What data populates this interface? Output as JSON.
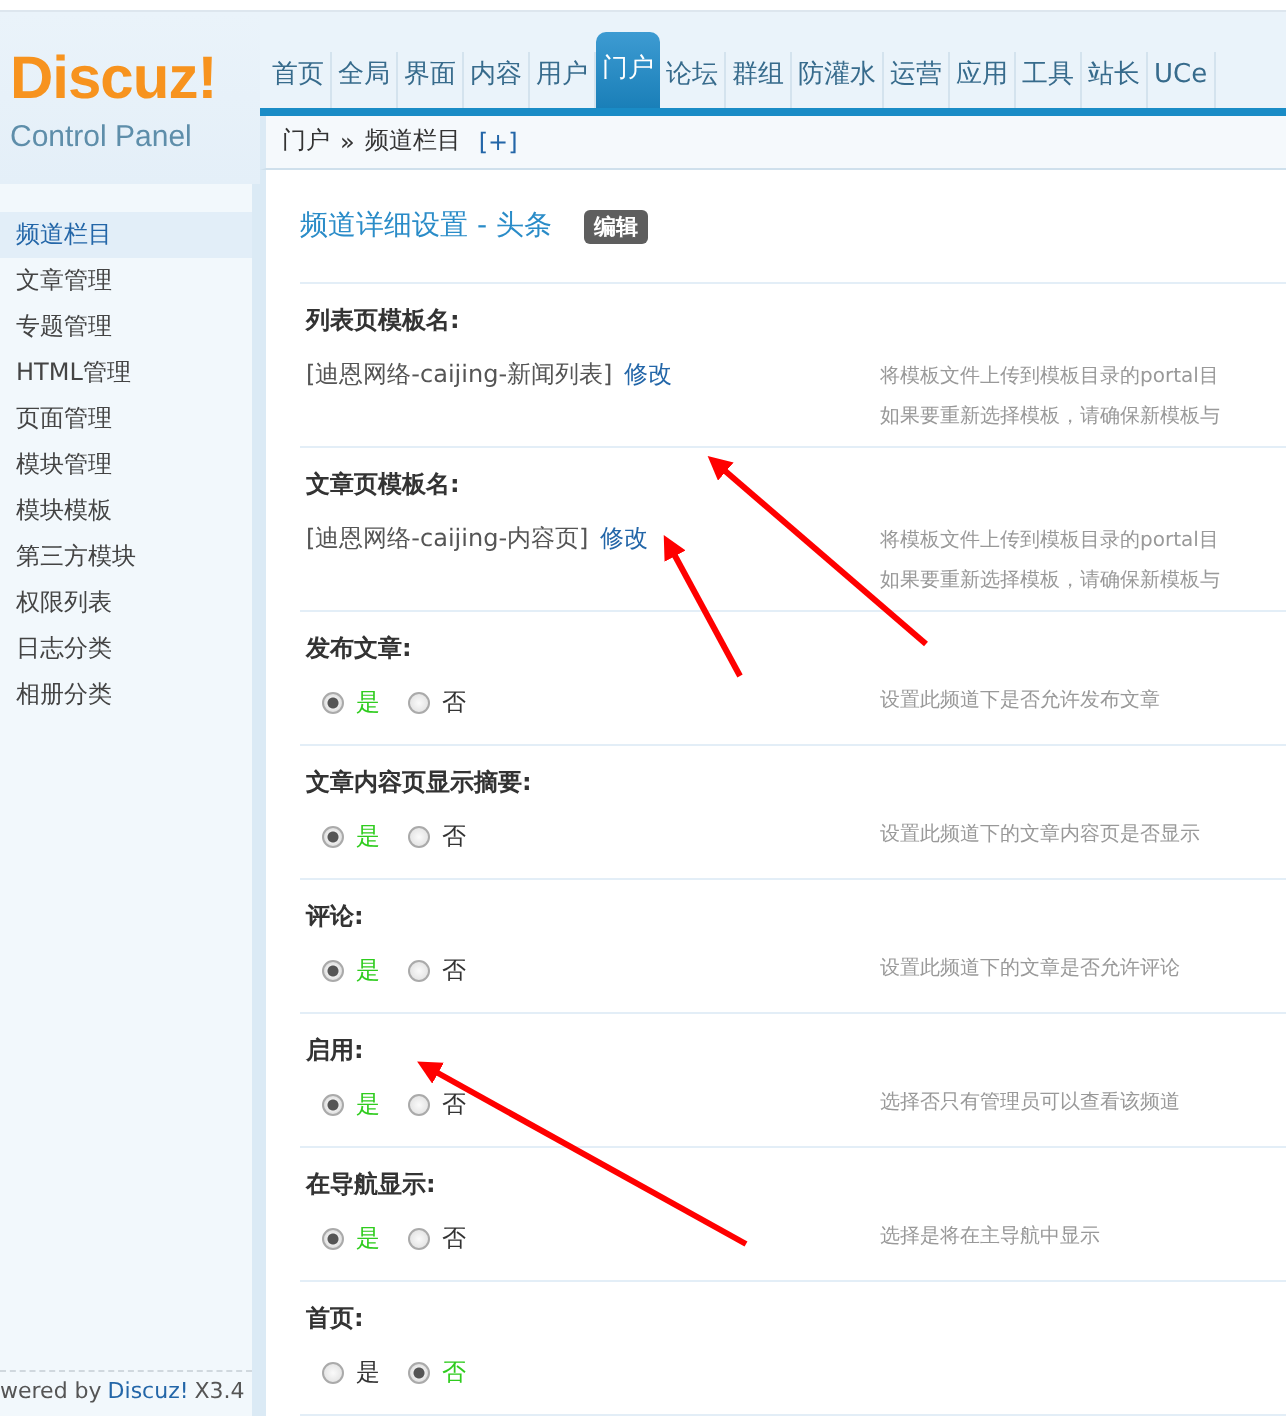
{
  "header": {
    "logo": "Discuz!",
    "subtitle": "Control Panel"
  },
  "nav": [
    {
      "label": "首页",
      "selected": false
    },
    {
      "label": "全局",
      "selected": false
    },
    {
      "label": "界面",
      "selected": false
    },
    {
      "label": "内容",
      "selected": false
    },
    {
      "label": "用户",
      "selected": false
    },
    {
      "label": "门户",
      "selected": true
    },
    {
      "label": "论坛",
      "selected": false
    },
    {
      "label": "群组",
      "selected": false
    },
    {
      "label": "防灌水",
      "selected": false
    },
    {
      "label": "运营",
      "selected": false
    },
    {
      "label": "应用",
      "selected": false
    },
    {
      "label": "工具",
      "selected": false
    },
    {
      "label": "站长",
      "selected": false
    },
    {
      "label": "UCe",
      "selected": false
    }
  ],
  "breadcrumb": {
    "parent": "门户",
    "separator": "»",
    "current": "频道栏目",
    "add": "[+]"
  },
  "sidebar": {
    "items": [
      {
        "label": "频道栏目",
        "selected": true
      },
      {
        "label": "文章管理",
        "selected": false
      },
      {
        "label": "专题管理",
        "selected": false
      },
      {
        "label": "HTML管理",
        "selected": false
      },
      {
        "label": "页面管理",
        "selected": false
      },
      {
        "label": "模块管理",
        "selected": false
      },
      {
        "label": "模块模板",
        "selected": false
      },
      {
        "label": "第三方模块",
        "selected": false
      },
      {
        "label": "权限列表",
        "selected": false
      },
      {
        "label": "日志分类",
        "selected": false
      },
      {
        "label": "相册分类",
        "selected": false
      }
    ],
    "footer": {
      "prefix": "wered by",
      "brand": "Discuz!",
      "version": "X3.4"
    }
  },
  "main": {
    "title": "频道详细设置 - 头条",
    "badge": "编辑",
    "settings": [
      {
        "kind": "template",
        "label": "列表页模板名:",
        "value": "[迪恩网络-caijing-新闻列表]",
        "link": "修改",
        "description": [
          "将模板文件上传到模板目录的portal目",
          "如果要重新选择模板，请确保新模板与"
        ]
      },
      {
        "kind": "template",
        "label": "文章页模板名:",
        "value": "[迪恩网络-caijing-内容页]",
        "link": "修改",
        "description": [
          "将模板文件上传到模板目录的portal目",
          "如果要重新选择模板，请确保新模板与"
        ]
      },
      {
        "kind": "radio",
        "label": "发布文章:",
        "options": [
          {
            "label": "是",
            "selected": true
          },
          {
            "label": "否",
            "selected": false
          }
        ],
        "description": [
          "设置此频道下是否允许发布文章"
        ]
      },
      {
        "kind": "radio",
        "label": "文章内容页显示摘要:",
        "options": [
          {
            "label": "是",
            "selected": true
          },
          {
            "label": "否",
            "selected": false
          }
        ],
        "description": [
          "设置此频道下的文章内容页是否显示"
        ]
      },
      {
        "kind": "radio",
        "label": "评论:",
        "options": [
          {
            "label": "是",
            "selected": true
          },
          {
            "label": "否",
            "selected": false
          }
        ],
        "description": [
          "设置此频道下的文章是否允许评论"
        ]
      },
      {
        "kind": "radio",
        "label": "启用:",
        "options": [
          {
            "label": "是",
            "selected": true
          },
          {
            "label": "否",
            "selected": false
          }
        ],
        "description": [
          "选择否只有管理员可以查看该频道"
        ]
      },
      {
        "kind": "radio",
        "label": "在导航显示:",
        "options": [
          {
            "label": "是",
            "selected": true
          },
          {
            "label": "否",
            "selected": false
          }
        ],
        "description": [
          "选择是将在主导航中显示"
        ]
      },
      {
        "kind": "radio",
        "label": "首页:",
        "options": [
          {
            "label": "是",
            "selected": false
          },
          {
            "label": "否",
            "selected": true
          }
        ]
      }
    ]
  }
}
